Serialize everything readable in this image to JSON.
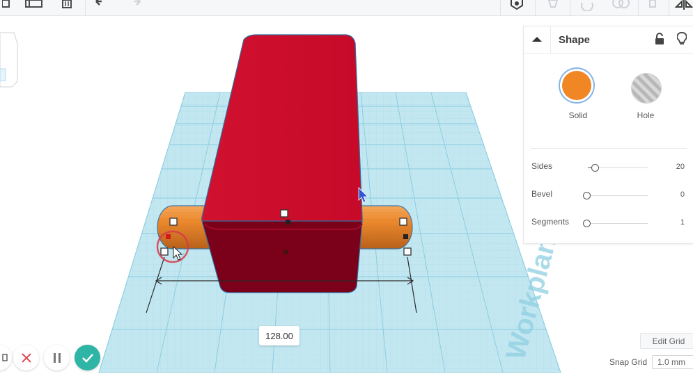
{
  "toolbar": {
    "tools": [
      "copy-icon",
      "duplicate-icon",
      "delete-icon",
      "undo-icon",
      "redo-icon"
    ],
    "right_tools": [
      "group-icon",
      "light-icon",
      "rotate-icon",
      "shape-icon",
      "align-icon",
      "mirror-icon"
    ]
  },
  "workplane": {
    "label": "Workplane",
    "dimension_value": "128.00"
  },
  "shape_panel": {
    "title": "Shape",
    "options": [
      {
        "label": "Solid",
        "color": "#f08624",
        "selected": true
      },
      {
        "label": "Hole",
        "color": "#c0c0c0",
        "selected": false
      }
    ],
    "params": [
      {
        "label": "Sides",
        "value": "20"
      },
      {
        "label": "Bevel",
        "value": "0"
      },
      {
        "label": "Segments",
        "value": "1"
      }
    ]
  },
  "bottom": {
    "edit_grid_label": "Edit Grid",
    "snap_grid_label": "Snap Grid",
    "snap_grid_value": "1.0 mm"
  },
  "colors": {
    "box": "#cc0a2a",
    "cylinder": "#ec8a2e",
    "workplane": "#bfe5ef",
    "grid": "#8fcfe2",
    "accent": "#2fb5a5"
  }
}
